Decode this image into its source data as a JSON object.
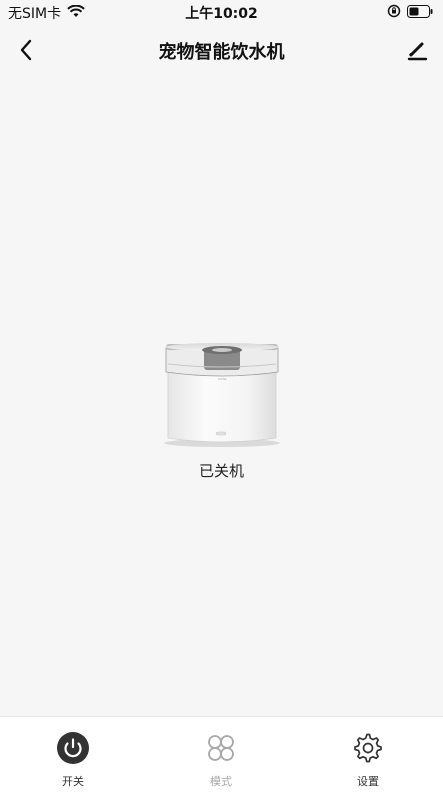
{
  "status_bar": {
    "carrier": "无SIM卡",
    "time": "上午10:02"
  },
  "nav": {
    "title": "宠物智能饮水机"
  },
  "device": {
    "status": "已关机",
    "brand": "mohb"
  },
  "tabs": [
    {
      "label": "开关",
      "icon": "power-icon"
    },
    {
      "label": "模式",
      "icon": "mode-icon",
      "disabled": true
    },
    {
      "label": "设置",
      "icon": "gear-icon"
    }
  ],
  "colors": {
    "background": "#f6f6f6",
    "power_button": "#333333",
    "disabled": "#a8a8a8"
  }
}
